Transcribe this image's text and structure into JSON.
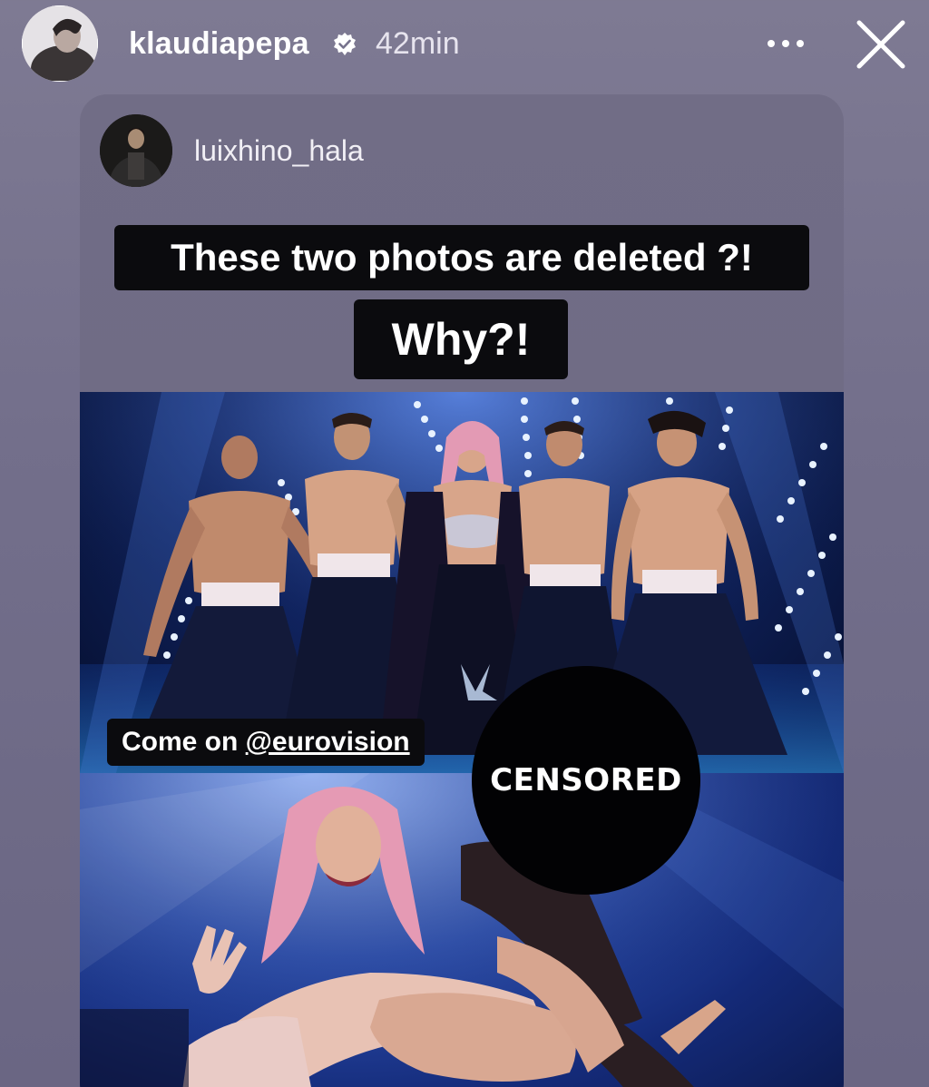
{
  "story": {
    "username": "klaudiapepa",
    "verified_icon": "verified-badge-icon",
    "timestamp": "42min",
    "more_icon": "more-horizontal-icon",
    "close_icon": "close-icon"
  },
  "shared_post": {
    "username": "luixhino_hala",
    "caption_line_1": "These two photos are deleted ?!",
    "caption_line_2": "Why?!",
    "sticker_prefix": "Come on ",
    "sticker_mention": "@eurovision",
    "censored_label": "CENSORED"
  },
  "colors": {
    "background": "#77738d",
    "caption_bg": "#0b0b0e",
    "stage_blue": "#1f3f9a"
  }
}
